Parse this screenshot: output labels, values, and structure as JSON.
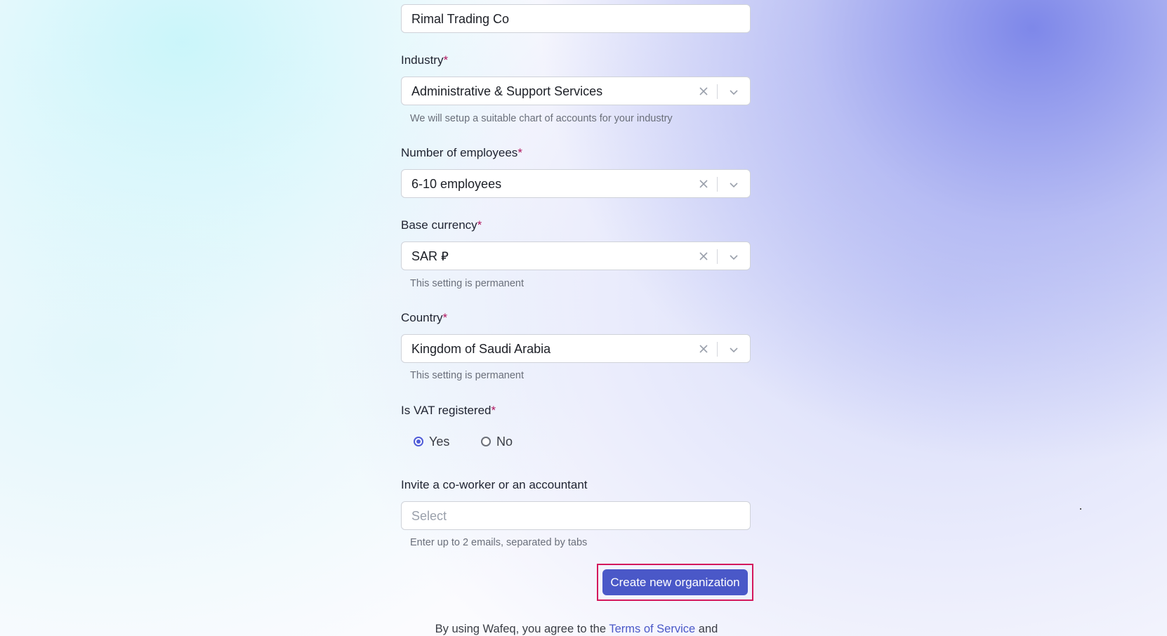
{
  "form": {
    "company_name": {
      "value": "Rimal Trading Co"
    },
    "industry": {
      "label": "Industry",
      "required_mark": "*",
      "value": "Administrative & Support Services",
      "help": "We will setup a suitable chart of accounts for your industry"
    },
    "employees": {
      "label": "Number of employees",
      "required_mark": "*",
      "value": "6-10 employees"
    },
    "currency": {
      "label": "Base currency",
      "required_mark": "*",
      "value": "SAR ⃁",
      "help": "This setting is permanent"
    },
    "country": {
      "label": "Country",
      "required_mark": "*",
      "value": "Kingdom of Saudi Arabia",
      "help": "This setting is permanent"
    },
    "vat": {
      "label": "Is VAT registered",
      "required_mark": "*",
      "options": [
        {
          "label": "Yes",
          "checked": true
        },
        {
          "label": "No",
          "checked": false
        }
      ]
    },
    "invite": {
      "label": "Invite a co-worker or an accountant",
      "placeholder": "Select",
      "help": "Enter up to 2 emails, separated by tabs"
    },
    "submit_label": "Create new organization"
  },
  "footer": {
    "prefix": "By using Wafeq, you agree to the",
    "terms_link": "Terms of Service",
    "suffix": "and"
  },
  "colors": {
    "accent": "#4a58c8",
    "required": "#b0155e",
    "highlight_outline": "#d4185c"
  }
}
